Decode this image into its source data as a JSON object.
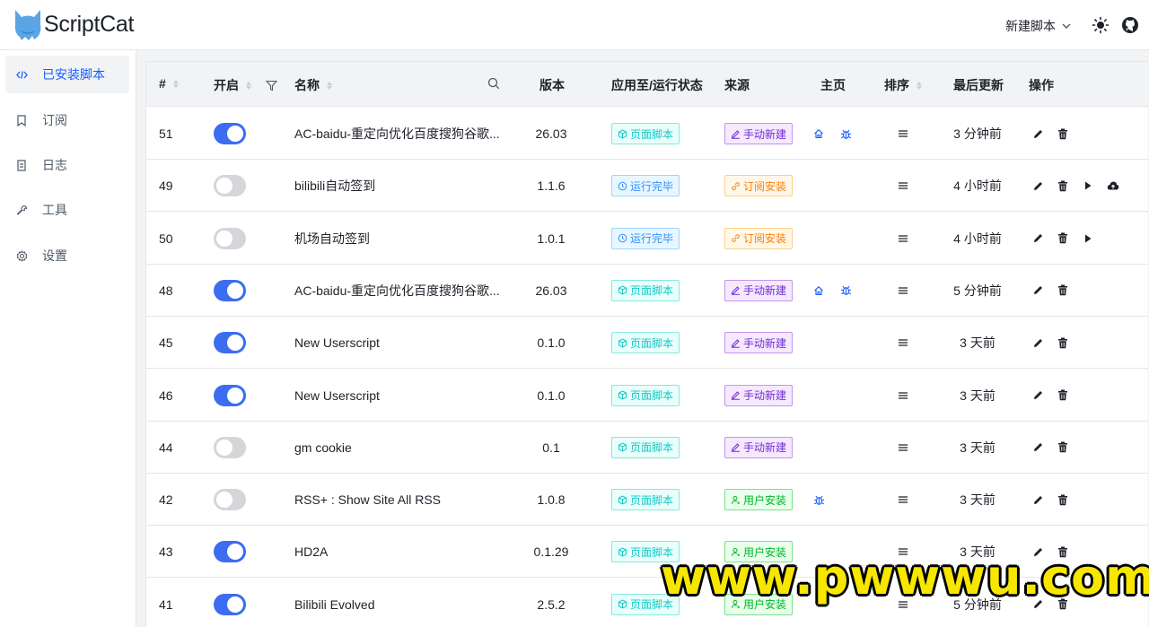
{
  "header": {
    "app_title": "ScriptCat",
    "new_script_label": "新建脚本",
    "icons": [
      "cat-logo-icon",
      "chevron-down-icon",
      "sun-icon",
      "github-icon"
    ]
  },
  "sidebar": {
    "items": [
      {
        "label": "已安装脚本",
        "icon": "code-icon",
        "active": true
      },
      {
        "label": "订阅",
        "icon": "bookmark-icon",
        "active": false
      },
      {
        "label": "日志",
        "icon": "file-icon",
        "active": false
      },
      {
        "label": "工具",
        "icon": "wrench-icon",
        "active": false
      },
      {
        "label": "设置",
        "icon": "gear-icon",
        "active": false
      }
    ]
  },
  "table": {
    "columns": {
      "id": "#",
      "enabled": "开启",
      "name": "名称",
      "version": "版本",
      "status": "应用至/运行状态",
      "source": "来源",
      "homepage": "主页",
      "sort": "排序",
      "updated": "最后更新",
      "actions": "操作"
    },
    "rows": [
      {
        "id": "51",
        "enabled": true,
        "name": "AC-baidu-重定向优化百度搜狗谷歌...",
        "version": "26.03",
        "status": "页面脚本",
        "status_type": "page",
        "source": "手动新建",
        "source_type": "manual",
        "home": [
          "home-icon",
          "bug-icon"
        ],
        "updated": "3 分钟前",
        "ops": [
          "edit-icon",
          "delete-icon"
        ]
      },
      {
        "id": "49",
        "enabled": false,
        "name": "bilibili自动签到",
        "version": "1.1.6",
        "status": "运行完毕",
        "status_type": "done",
        "source": "订阅安装",
        "source_type": "subscribe",
        "home": [],
        "updated": "4 小时前",
        "ops": [
          "edit-icon",
          "delete-icon",
          "play-icon",
          "cloud-upload-icon"
        ]
      },
      {
        "id": "50",
        "enabled": false,
        "name": "机场自动签到",
        "version": "1.0.1",
        "status": "运行完毕",
        "status_type": "done",
        "source": "订阅安装",
        "source_type": "subscribe",
        "home": [],
        "updated": "4 小时前",
        "ops": [
          "edit-icon",
          "delete-icon",
          "play-icon"
        ]
      },
      {
        "id": "48",
        "enabled": true,
        "name": "AC-baidu-重定向优化百度搜狗谷歌...",
        "version": "26.03",
        "status": "页面脚本",
        "status_type": "page",
        "source": "手动新建",
        "source_type": "manual",
        "home": [
          "home-icon",
          "bug-icon"
        ],
        "updated": "5 分钟前",
        "ops": [
          "edit-icon",
          "delete-icon"
        ]
      },
      {
        "id": "45",
        "enabled": true,
        "name": "New Userscript",
        "version": "0.1.0",
        "status": "页面脚本",
        "status_type": "page",
        "source": "手动新建",
        "source_type": "manual",
        "home": [],
        "updated": "3 天前",
        "ops": [
          "edit-icon",
          "delete-icon"
        ]
      },
      {
        "id": "46",
        "enabled": true,
        "name": "New Userscript",
        "version": "0.1.0",
        "status": "页面脚本",
        "status_type": "page",
        "source": "手动新建",
        "source_type": "manual",
        "home": [],
        "updated": "3 天前",
        "ops": [
          "edit-icon",
          "delete-icon"
        ]
      },
      {
        "id": "44",
        "enabled": false,
        "name": "gm cookie",
        "version": "0.1",
        "status": "页面脚本",
        "status_type": "page",
        "source": "手动新建",
        "source_type": "manual",
        "home": [],
        "updated": "3 天前",
        "ops": [
          "edit-icon",
          "delete-icon"
        ]
      },
      {
        "id": "42",
        "enabled": false,
        "name": "RSS+ : Show Site All RSS",
        "version": "1.0.8",
        "status": "页面脚本",
        "status_type": "page",
        "source": "用户安装",
        "source_type": "user",
        "home": [
          "bug-icon"
        ],
        "updated": "3 天前",
        "ops": [
          "edit-icon",
          "delete-icon"
        ]
      },
      {
        "id": "43",
        "enabled": true,
        "name": "HD2A",
        "version": "0.1.29",
        "status": "页面脚本",
        "status_type": "page",
        "source": "用户安装",
        "source_type": "user",
        "home": [],
        "updated": "3 天前",
        "ops": [
          "edit-icon",
          "delete-icon"
        ]
      },
      {
        "id": "41",
        "enabled": true,
        "name": "Bilibili Evolved",
        "version": "2.5.2",
        "status": "页面脚本",
        "status_type": "page",
        "source": "用户安装",
        "source_type": "user",
        "home": [],
        "updated": "5 分钟前",
        "ops": [
          "edit-icon",
          "delete-icon"
        ]
      }
    ]
  },
  "watermark": "www.pwwwu.com",
  "colors": {
    "accent": "#165dff",
    "toggle_on": "#3c6df0",
    "toggle_off": "#d4d6da",
    "tag_page": "#14c9c9",
    "tag_done": "#3491fa",
    "tag_manual": "#722ed1",
    "tag_subscribe": "#ff7d00",
    "tag_user": "#00b42a",
    "watermark": "#f7e600"
  }
}
